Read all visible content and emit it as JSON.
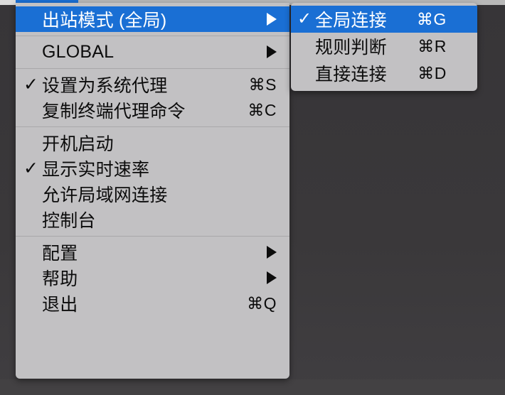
{
  "colors": {
    "menu_background": "#c2c1c3",
    "highlight": "#1a6fd4",
    "text": "#0c0c0c",
    "highlight_text": "#ffffff",
    "separator": "#a9a8aa",
    "desktop": "#393739"
  },
  "glyphs": {
    "checkmark": "✓",
    "command": "⌘",
    "submenu_arrow": "▶"
  },
  "main_menu": {
    "sections": [
      {
        "items": [
          {
            "label": "出站模式 (全局)",
            "checked": false,
            "shortcut": "",
            "has_submenu": true,
            "selected": true
          }
        ]
      },
      {
        "items": [
          {
            "label": "GLOBAL",
            "checked": false,
            "shortcut": "",
            "has_submenu": true,
            "selected": false
          }
        ]
      },
      {
        "items": [
          {
            "label": "设置为系统代理",
            "checked": true,
            "shortcut": "⌘S",
            "has_submenu": false,
            "selected": false
          },
          {
            "label": "复制终端代理命令",
            "checked": false,
            "shortcut": "⌘C",
            "has_submenu": false,
            "selected": false
          }
        ]
      },
      {
        "items": [
          {
            "label": "开机启动",
            "checked": false,
            "shortcut": "",
            "has_submenu": false,
            "selected": false
          },
          {
            "label": "显示实时速率",
            "checked": true,
            "shortcut": "",
            "has_submenu": false,
            "selected": false
          },
          {
            "label": "允许局域网连接",
            "checked": false,
            "shortcut": "",
            "has_submenu": false,
            "selected": false
          },
          {
            "label": "控制台",
            "checked": false,
            "shortcut": "",
            "has_submenu": false,
            "selected": false
          }
        ]
      },
      {
        "items": [
          {
            "label": "配置",
            "checked": false,
            "shortcut": "",
            "has_submenu": true,
            "selected": false
          },
          {
            "label": "帮助",
            "checked": false,
            "shortcut": "",
            "has_submenu": true,
            "selected": false
          },
          {
            "label": "退出",
            "checked": false,
            "shortcut": "⌘Q",
            "has_submenu": false,
            "selected": false
          }
        ]
      }
    ]
  },
  "submenu": {
    "parent": "出站模式 (全局)",
    "items": [
      {
        "label": "全局连接",
        "checked": true,
        "shortcut": "⌘G",
        "selected": true
      },
      {
        "label": "规则判断",
        "checked": false,
        "shortcut": "⌘R",
        "selected": false
      },
      {
        "label": "直接连接",
        "checked": false,
        "shortcut": "⌘D",
        "selected": false
      }
    ]
  }
}
